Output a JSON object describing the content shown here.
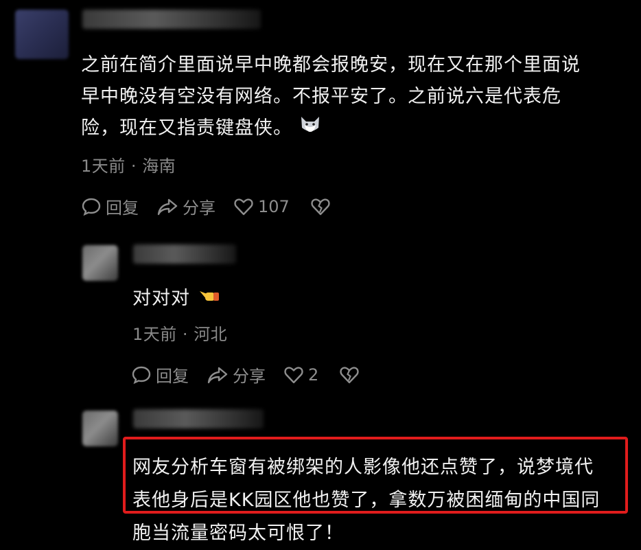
{
  "comment1": {
    "text_lines": [
      "之前在简介里面说早中晚都会报晚安，现在又在那个里面说",
      "早中晚没有空没有网络。不报平安了。之前说六是代表危",
      "险，现在又指责键盘侠。"
    ],
    "emoji": "cat-face-emoji",
    "time": "1天前",
    "location": "海南",
    "reply_label": "回复",
    "share_label": "分享",
    "like_count": "107"
  },
  "reply1": {
    "text": "对对对",
    "emoji": "pointing-hand-emoji",
    "time": "1天前",
    "location": "河北",
    "reply_label": "回复",
    "share_label": "分享",
    "like_count": "2"
  },
  "reply2": {
    "text_lines": [
      "网友分析车窗有被绑架的人影像他还点赞了，说梦境代",
      "表他身后是KK园区他也赞了，拿数万被困缅甸的中国同",
      "胞当流量密码太可恨了！"
    ],
    "highlight_color": "#e01c1c"
  },
  "separator": "·"
}
